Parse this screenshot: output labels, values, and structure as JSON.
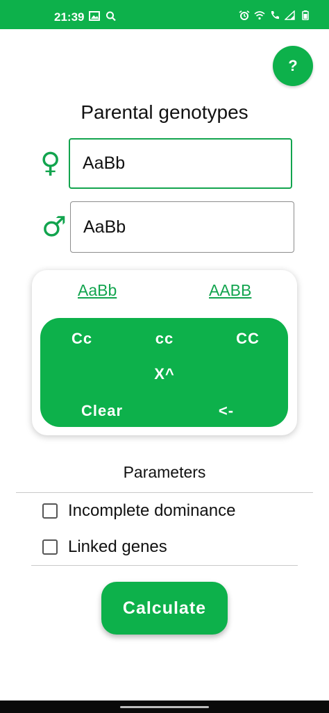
{
  "status_bar": {
    "time": "21:39",
    "left_icons": [
      "image-icon",
      "search-icon"
    ],
    "right_icons": [
      "alarm-icon",
      "wifi-icon",
      "call-icon",
      "signal-icon",
      "battery-icon"
    ],
    "color": "#0db14b"
  },
  "help_button": {
    "label": "?"
  },
  "title": "Parental genotypes",
  "female": {
    "symbol": "♀",
    "value": "AaBb"
  },
  "male": {
    "symbol": "♂",
    "value": "AaBb"
  },
  "suggestions": [
    "AaBb",
    "AABB"
  ],
  "keypad": {
    "keys": [
      "Cc",
      "cc",
      "CC",
      "X^",
      "Clear",
      "<-"
    ]
  },
  "parameters": {
    "title": "Parameters",
    "options": [
      {
        "label": "Incomplete dominance",
        "checked": false
      },
      {
        "label": "Linked genes",
        "checked": false
      }
    ]
  },
  "calculate_label": "Calculate",
  "colors": {
    "accent": "#0db14b",
    "sex_icon": "#12a44e"
  }
}
